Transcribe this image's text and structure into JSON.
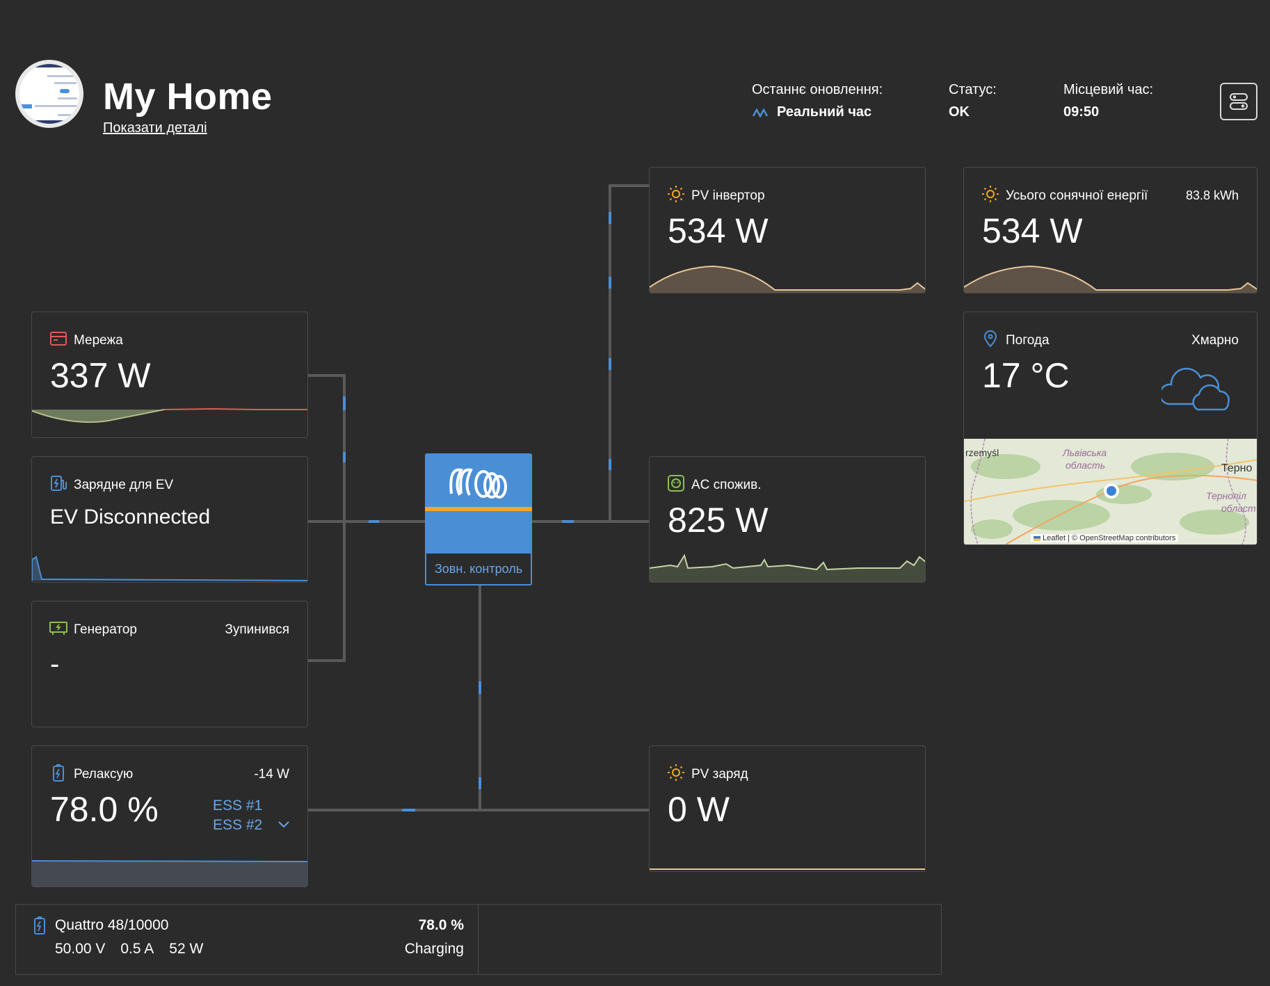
{
  "site": {
    "title": "My Home",
    "details_link": "Показати деталі"
  },
  "header": {
    "last_update_label": "Останнє оновлення:",
    "last_update_value": "Реальний час",
    "status_label": "Статус:",
    "status_value": "OK",
    "local_time_label": "Місцевий час:",
    "local_time_value": "09:50"
  },
  "grid": {
    "title": "Мережа",
    "value": "337 W"
  },
  "ev": {
    "title": "Зарядне для EV",
    "value": "EV Disconnected"
  },
  "generator": {
    "title": "Генератор",
    "status": "Зупинився",
    "value": "-"
  },
  "battery": {
    "title": "Релаксую",
    "power": "-14 W",
    "value": "78.0 %",
    "ess1": "ESS #1",
    "ess2": "ESS #2"
  },
  "inverter": {
    "label": "Зовн. контроль"
  },
  "pv_inverter": {
    "title": "PV інвертор",
    "value": "534 W"
  },
  "ac_loads": {
    "title": "AC спожив.",
    "value": "825 W"
  },
  "pv_charger": {
    "title": "PV заряд",
    "value": "0 W"
  },
  "solar_total": {
    "title": "Усього сонячної енергії",
    "total": "83.8 kWh",
    "value": "534 W"
  },
  "weather": {
    "title": "Погода",
    "condition": "Хмарно",
    "value": "17 °C",
    "map_labels": {
      "city_left": "rzemyśl",
      "region1_a": "Львівська",
      "region1_b": "область",
      "city_right": "Терно",
      "region2_a": "Тернопіл",
      "region2_b": "област"
    },
    "attribution": "Leaflet | © OpenStreetMap contributors"
  },
  "battery_detail": {
    "name": "Quattro 48/10000",
    "voltage": "50.00 V",
    "current": "0.5 A",
    "power": "52 W",
    "soc": "78.0 %",
    "state": "Charging"
  },
  "colors": {
    "background": "#2b2b2b",
    "accent_blue": "#4a8fd6",
    "solar_orange": "#f5a623",
    "grid_red": "#e05a5a",
    "ac_green": "#8bc34a"
  }
}
